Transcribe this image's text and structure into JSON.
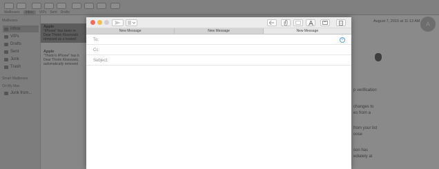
{
  "background": {
    "toolbar_filters": [
      "Mailboxes",
      "Inbox",
      "VIPs",
      "Sent",
      "Drafts"
    ],
    "sidebar": {
      "section_mailboxes": "Mailboxes",
      "items": [
        {
          "label": "Inbox",
          "icon": "inbox-icon"
        },
        {
          "label": "VIPs",
          "icon": "star-icon"
        },
        {
          "label": "Drafts",
          "icon": "drafts-icon"
        },
        {
          "label": "Sent",
          "icon": "sent-icon"
        },
        {
          "label": "Junk",
          "icon": "junk-icon"
        },
        {
          "label": "Trash",
          "icon": "trash-icon"
        }
      ],
      "section_smart": "Smart Mailboxes",
      "section_onmac": "On My Mac",
      "onmac_item": "Junk from..."
    },
    "message_list": [
      {
        "from": "Apple",
        "subject": "\"iPhone\" has been re",
        "preview": "Dear Thorin Klosowski removed as a trusted"
      },
      {
        "from": "Apple",
        "subject": "\"Thorin's iPhone\" has b",
        "preview": "Dear Thorin Klosowski, automatically removed"
      }
    ],
    "detail": {
      "date": "August 7, 2015 at 11:13 AM",
      "avatar_initial": "A",
      "lines": [
        "p verification",
        "changes to",
        "es from a",
        "from your list",
        "oose",
        "son has",
        "ediately at"
      ]
    }
  },
  "compose": {
    "tabs": [
      "New Message",
      "New Message",
      "New Message"
    ],
    "active_tab": 2,
    "fields": {
      "to_label": "To:",
      "cc_label": "Cc:",
      "subject_label": "Subject:",
      "to_value": "",
      "cc_value": "",
      "subject_value": ""
    },
    "add_contact_symbol": "+",
    "colors": {
      "close": "#ed6b5f",
      "minimize": "#f5be4f",
      "zoom": "#cfcfcf"
    }
  }
}
